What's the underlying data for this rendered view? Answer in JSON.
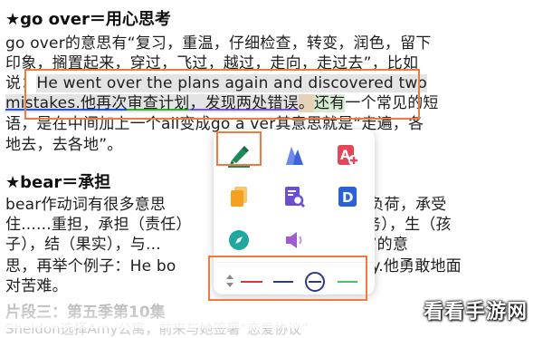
{
  "document": {
    "heading1": "★go over＝用心思考",
    "para1": {
      "line1": "go over的意思有“复习，重温，仔细检查，转变，润色，留下",
      "line2": "印象，搁置起来，穿过，飞过，越过，走向，走过去”，比如",
      "line3_a": "说：",
      "line3_b": "He went over the plans again and discovered two",
      "line4_a": "mistakes.他再次",
      "line4_b": "审查计划",
      "line4_c": "，发现两处错误",
      "line4_d": "。",
      "line4_e": "还有",
      "line4_f": "一个常见的短",
      "line5": "语，是在中间加上一个all变成go a     ver其意思就是“走遍，各",
      "line6": "地去，去各地”。"
    },
    "heading2": "★bear＝承担",
    "para2": {
      "line1_a": "bear作动词有很多意思",
      "line1_b": "持，负荷，承受",
      "line2_a": "住......重担，承担（责任）",
      "line2_b": "中义务），生（孩",
      "line3_a": "子），结（果实），与...",
      "line3_b": "则是“承担”的意",
      "line4_a": "思，再举个例子：He bo",
      "line4_b": "nfully.他勇敢地面",
      "line5": "对苦难。"
    },
    "section3": "片段三：第五季第10集",
    "faded_line": "Sheldon选择Amy公寓，前来与她签署“恋爱协议”"
  },
  "toolbar": {
    "tools": [
      {
        "name": "highlighter-pen-icon",
        "color": "#1e8a5a"
      },
      {
        "name": "wave-underline-icon",
        "color": "#3d64d8"
      },
      {
        "name": "add-text-icon",
        "color": "#e2485a"
      },
      {
        "name": "copy-icon",
        "color": "#f5a020"
      },
      {
        "name": "search-doc-icon",
        "color": "#6a4fd0"
      },
      {
        "name": "dictionary-icon",
        "color": "#2a62d6"
      },
      {
        "name": "compass-icon",
        "color": "#1fa8a0"
      },
      {
        "name": "speaker-icon",
        "color": "#a05ad6"
      }
    ],
    "colors": [
      "#d43a3a",
      "#2c3a8c",
      "#2c3a8c",
      "#3ec95a"
    ]
  },
  "watermark": "看看手游网"
}
